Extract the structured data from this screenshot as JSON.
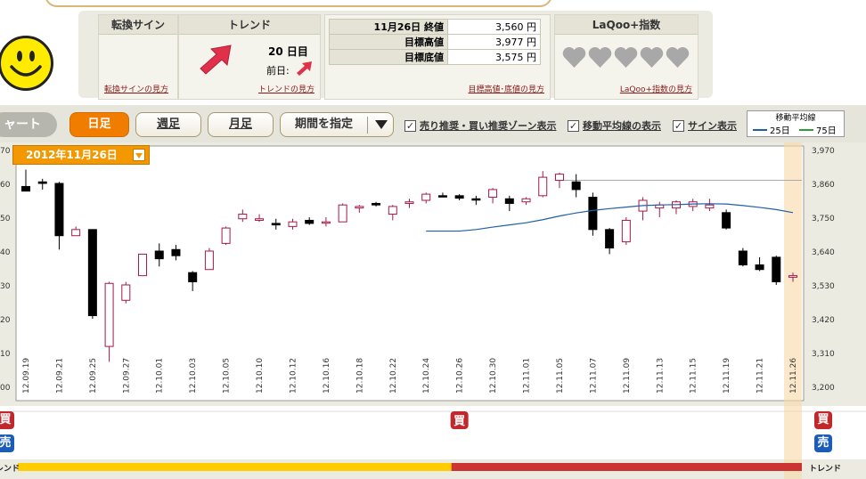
{
  "summary": {
    "sign": {
      "title": "転換サイン",
      "link": "転換サインの見方"
    },
    "trend": {
      "title": "トレンド",
      "days": "20 日目",
      "prev_label": "前日:",
      "link": "トレンドの見方"
    },
    "target": {
      "rows": [
        {
          "label": "11月26日 終値",
          "value": "3,560 円"
        },
        {
          "label": "目標高値",
          "value": "3,977 円"
        },
        {
          "label": "目標底値",
          "value": "3,575 円"
        }
      ],
      "link": "目標高値･底値の見方"
    },
    "laqoo": {
      "title": "LaQoo+指数",
      "link": "LaQoo+指数の見方",
      "hearts": 5
    }
  },
  "toolbar": {
    "chart_tab": "ャート",
    "day": "日足",
    "week": "週足",
    "month": "月足",
    "range": "期間を指定",
    "chk_zone": "売り推奨・買い推奨ゾーン表示",
    "chk_ma": "移動平均線の表示",
    "chk_sign": "サイン表示",
    "ma_legend_title": "移動平均線",
    "ma25": "25日",
    "ma75": "75日"
  },
  "chart": {
    "date_badge": "2012年11月26日",
    "signal_buy": "買",
    "signal_sell": "売",
    "trend_label": "トレンド"
  },
  "colors": {
    "accent": "#f07d00",
    "up": "#a5174b",
    "down": "#000000",
    "ma25": "#1f5fa8",
    "ma75": "#2e9e3a",
    "trend_up": "#ffcc00",
    "trend_down": "#cc3333"
  },
  "chart_data": {
    "type": "candlestick",
    "ylim": [
      3200,
      3970
    ],
    "right_ticks": [
      "3,970",
      "3,860",
      "3,750",
      "3,640",
      "3,530",
      "3,420",
      "3,310",
      "3,200"
    ],
    "left_ticks": [
      "70",
      "60",
      "50",
      "40",
      "30",
      "20",
      "10",
      "00"
    ],
    "x_labels": [
      "12.09.19",
      "12.09.21",
      "12.09.25",
      "12.09.27",
      "12.10.01",
      "12.10.03",
      "12.10.05",
      "12.10.10",
      "12.10.12",
      "12.10.16",
      "12.10.18",
      "12.10.22",
      "12.10.24",
      "12.10.26",
      "12.10.30",
      "12.11.01",
      "12.11.05",
      "12.11.07",
      "12.11.09",
      "12.11.13",
      "12.11.15",
      "12.11.19",
      "12.11.21",
      "12.11.26"
    ],
    "candles": [
      {
        "d": "12.09.19",
        "o": 3850,
        "h": 3905,
        "l": 3840,
        "c": 3835
      },
      {
        "d": "12.09.20",
        "o": 3865,
        "h": 3875,
        "l": 3840,
        "c": 3860
      },
      {
        "d": "12.09.21",
        "o": 3860,
        "h": 3865,
        "l": 3645,
        "c": 3690
      },
      {
        "d": "12.09.24",
        "o": 3690,
        "h": 3720,
        "l": 3690,
        "c": 3710
      },
      {
        "d": "12.09.25",
        "o": 3710,
        "h": 3710,
        "l": 3420,
        "c": 3430
      },
      {
        "d": "12.09.26",
        "o": 3330,
        "h": 3540,
        "l": 3280,
        "c": 3535
      },
      {
        "d": "12.09.27",
        "o": 3480,
        "h": 3540,
        "l": 3470,
        "c": 3530
      },
      {
        "d": "12.09.28",
        "o": 3560,
        "h": 3630,
        "l": 3560,
        "c": 3630
      },
      {
        "d": "12.10.01",
        "o": 3640,
        "h": 3665,
        "l": 3590,
        "c": 3615
      },
      {
        "d": "12.10.02",
        "o": 3645,
        "h": 3660,
        "l": 3610,
        "c": 3625
      },
      {
        "d": "12.10.03",
        "o": 3570,
        "h": 3575,
        "l": 3510,
        "c": 3540
      },
      {
        "d": "12.10.04",
        "o": 3580,
        "h": 3650,
        "l": 3580,
        "c": 3640
      },
      {
        "d": "12.10.05",
        "o": 3665,
        "h": 3720,
        "l": 3660,
        "c": 3715
      },
      {
        "d": "12.10.09",
        "o": 3745,
        "h": 3775,
        "l": 3735,
        "c": 3760
      },
      {
        "d": "12.10.10",
        "o": 3740,
        "h": 3760,
        "l": 3735,
        "c": 3745
      },
      {
        "d": "12.10.11",
        "o": 3730,
        "h": 3745,
        "l": 3710,
        "c": 3725
      },
      {
        "d": "12.10.12",
        "o": 3720,
        "h": 3745,
        "l": 3710,
        "c": 3735
      },
      {
        "d": "12.10.15",
        "o": 3740,
        "h": 3750,
        "l": 3725,
        "c": 3730
      },
      {
        "d": "12.10.16",
        "o": 3735,
        "h": 3750,
        "l": 3720,
        "c": 3735
      },
      {
        "d": "12.10.17",
        "o": 3735,
        "h": 3795,
        "l": 3735,
        "c": 3790
      },
      {
        "d": "12.10.18",
        "o": 3780,
        "h": 3790,
        "l": 3765,
        "c": 3785
      },
      {
        "d": "12.10.19",
        "o": 3795,
        "h": 3800,
        "l": 3785,
        "c": 3790
      },
      {
        "d": "12.10.22",
        "o": 3760,
        "h": 3790,
        "l": 3740,
        "c": 3785
      },
      {
        "d": "12.10.23",
        "o": 3795,
        "h": 3810,
        "l": 3780,
        "c": 3800
      },
      {
        "d": "12.10.24",
        "o": 3805,
        "h": 3830,
        "l": 3795,
        "c": 3825
      },
      {
        "d": "12.10.25",
        "o": 3820,
        "h": 3830,
        "l": 3815,
        "c": 3818
      },
      {
        "d": "12.10.26",
        "o": 3820,
        "h": 3825,
        "l": 3805,
        "c": 3812
      },
      {
        "d": "12.10.29",
        "o": 3810,
        "h": 3820,
        "l": 3790,
        "c": 3808
      },
      {
        "d": "12.10.30",
        "o": 3815,
        "h": 3845,
        "l": 3795,
        "c": 3840
      },
      {
        "d": "12.10.31",
        "o": 3810,
        "h": 3820,
        "l": 3770,
        "c": 3795
      },
      {
        "d": "12.11.01",
        "o": 3800,
        "h": 3815,
        "l": 3790,
        "c": 3810
      },
      {
        "d": "12.11.02",
        "o": 3820,
        "h": 3900,
        "l": 3815,
        "c": 3880
      },
      {
        "d": "12.11.05",
        "o": 3870,
        "h": 3895,
        "l": 3845,
        "c": 3890
      },
      {
        "d": "12.11.06",
        "o": 3865,
        "h": 3890,
        "l": 3815,
        "c": 3840
      },
      {
        "d": "12.11.07",
        "o": 3815,
        "h": 3830,
        "l": 3690,
        "c": 3710
      },
      {
        "d": "12.11.08",
        "o": 3710,
        "h": 3715,
        "l": 3630,
        "c": 3650
      },
      {
        "d": "12.11.09",
        "o": 3670,
        "h": 3750,
        "l": 3660,
        "c": 3740
      },
      {
        "d": "12.11.12",
        "o": 3770,
        "h": 3815,
        "l": 3740,
        "c": 3805
      },
      {
        "d": "12.11.13",
        "o": 3780,
        "h": 3800,
        "l": 3750,
        "c": 3790
      },
      {
        "d": "12.11.14",
        "o": 3780,
        "h": 3805,
        "l": 3760,
        "c": 3800
      },
      {
        "d": "12.11.15",
        "o": 3785,
        "h": 3810,
        "l": 3770,
        "c": 3800
      },
      {
        "d": "12.11.16",
        "o": 3780,
        "h": 3810,
        "l": 3770,
        "c": 3790
      },
      {
        "d": "12.11.19",
        "o": 3765,
        "h": 3775,
        "l": 3710,
        "c": 3715
      },
      {
        "d": "12.11.20",
        "o": 3640,
        "h": 3650,
        "l": 3590,
        "c": 3595
      },
      {
        "d": "12.11.21",
        "o": 3595,
        "h": 3620,
        "l": 3575,
        "c": 3580
      },
      {
        "d": "12.11.22",
        "o": 3620,
        "h": 3625,
        "l": 3530,
        "c": 3540
      },
      {
        "d": "12.11.26",
        "o": 3555,
        "h": 3570,
        "l": 3540,
        "c": 3560
      }
    ],
    "ma25": [
      {
        "d": "12.10.24",
        "v": 3705
      },
      {
        "d": "12.10.26",
        "v": 3705
      },
      {
        "d": "12.10.29",
        "v": 3710
      },
      {
        "d": "12.10.30",
        "v": 3718
      },
      {
        "d": "12.10.31",
        "v": 3725
      },
      {
        "d": "12.11.01",
        "v": 3732
      },
      {
        "d": "12.11.02",
        "v": 3742
      },
      {
        "d": "12.11.05",
        "v": 3754
      },
      {
        "d": "12.11.06",
        "v": 3764
      },
      {
        "d": "12.11.07",
        "v": 3772
      },
      {
        "d": "12.11.08",
        "v": 3778
      },
      {
        "d": "12.11.09",
        "v": 3783
      },
      {
        "d": "12.11.12",
        "v": 3788
      },
      {
        "d": "12.11.13",
        "v": 3790
      },
      {
        "d": "12.11.14",
        "v": 3791
      },
      {
        "d": "12.11.15",
        "v": 3793
      },
      {
        "d": "12.11.16",
        "v": 3794
      },
      {
        "d": "12.11.19",
        "v": 3793
      },
      {
        "d": "12.11.20",
        "v": 3788
      },
      {
        "d": "12.11.21",
        "v": 3782
      },
      {
        "d": "12.11.22",
        "v": 3775
      },
      {
        "d": "12.11.26",
        "v": 3765
      }
    ],
    "target_high": 3870,
    "signals": [
      {
        "type": "buy",
        "d": "12.10.26"
      }
    ],
    "trend_segments": [
      {
        "from": "12.09.19",
        "to": "12.10.26",
        "state": "up"
      },
      {
        "from": "12.10.26",
        "to": "12.11.26",
        "state": "down"
      }
    ]
  }
}
